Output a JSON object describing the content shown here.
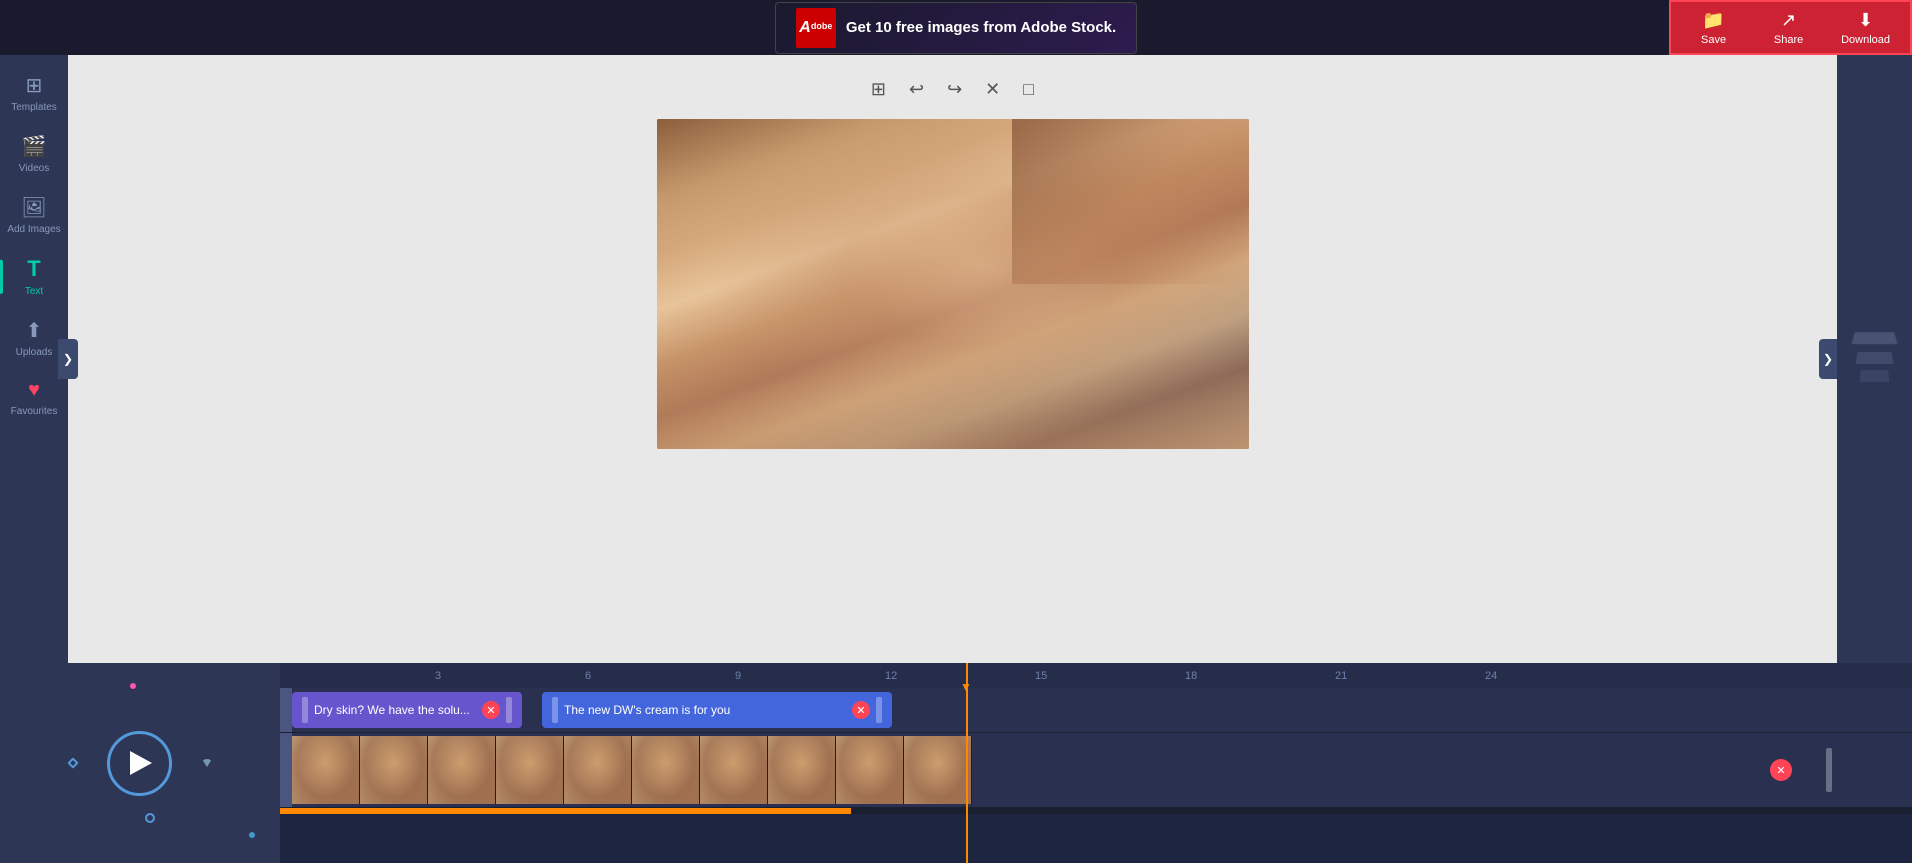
{
  "ad": {
    "logo_text": "Ad",
    "text": "Get 10 free images from Adobe Stock."
  },
  "toolbar": {
    "save_label": "Save",
    "share_label": "Share",
    "download_label": "Download"
  },
  "sidebar": {
    "items": [
      {
        "id": "templates",
        "label": "Templates",
        "icon": "⊞"
      },
      {
        "id": "videos",
        "label": "Videos",
        "icon": "🎬"
      },
      {
        "id": "add-images",
        "label": "Add Images",
        "icon": "🖼"
      },
      {
        "id": "text",
        "label": "Text",
        "icon": "T"
      },
      {
        "id": "uploads",
        "label": "Uploads",
        "icon": "⬆"
      },
      {
        "id": "favourites",
        "label": "Favourites",
        "icon": "♥"
      }
    ]
  },
  "timeline": {
    "ruler_marks": [
      "3",
      "6",
      "9",
      "12",
      "15",
      "18",
      "21",
      "24"
    ],
    "text_segments": [
      {
        "id": "seg1",
        "text": "Dry skin? We have the solu...",
        "color": "#6655cc"
      },
      {
        "id": "seg2",
        "text": "The new DW's cream is for you",
        "color": "#4466dd"
      }
    ]
  },
  "icons": {
    "grid": "⊞",
    "undo": "↩",
    "redo": "↪",
    "close": "✕",
    "expand": "□",
    "play": "▶",
    "chevron_right": "❯",
    "chevron_left": "❮"
  }
}
